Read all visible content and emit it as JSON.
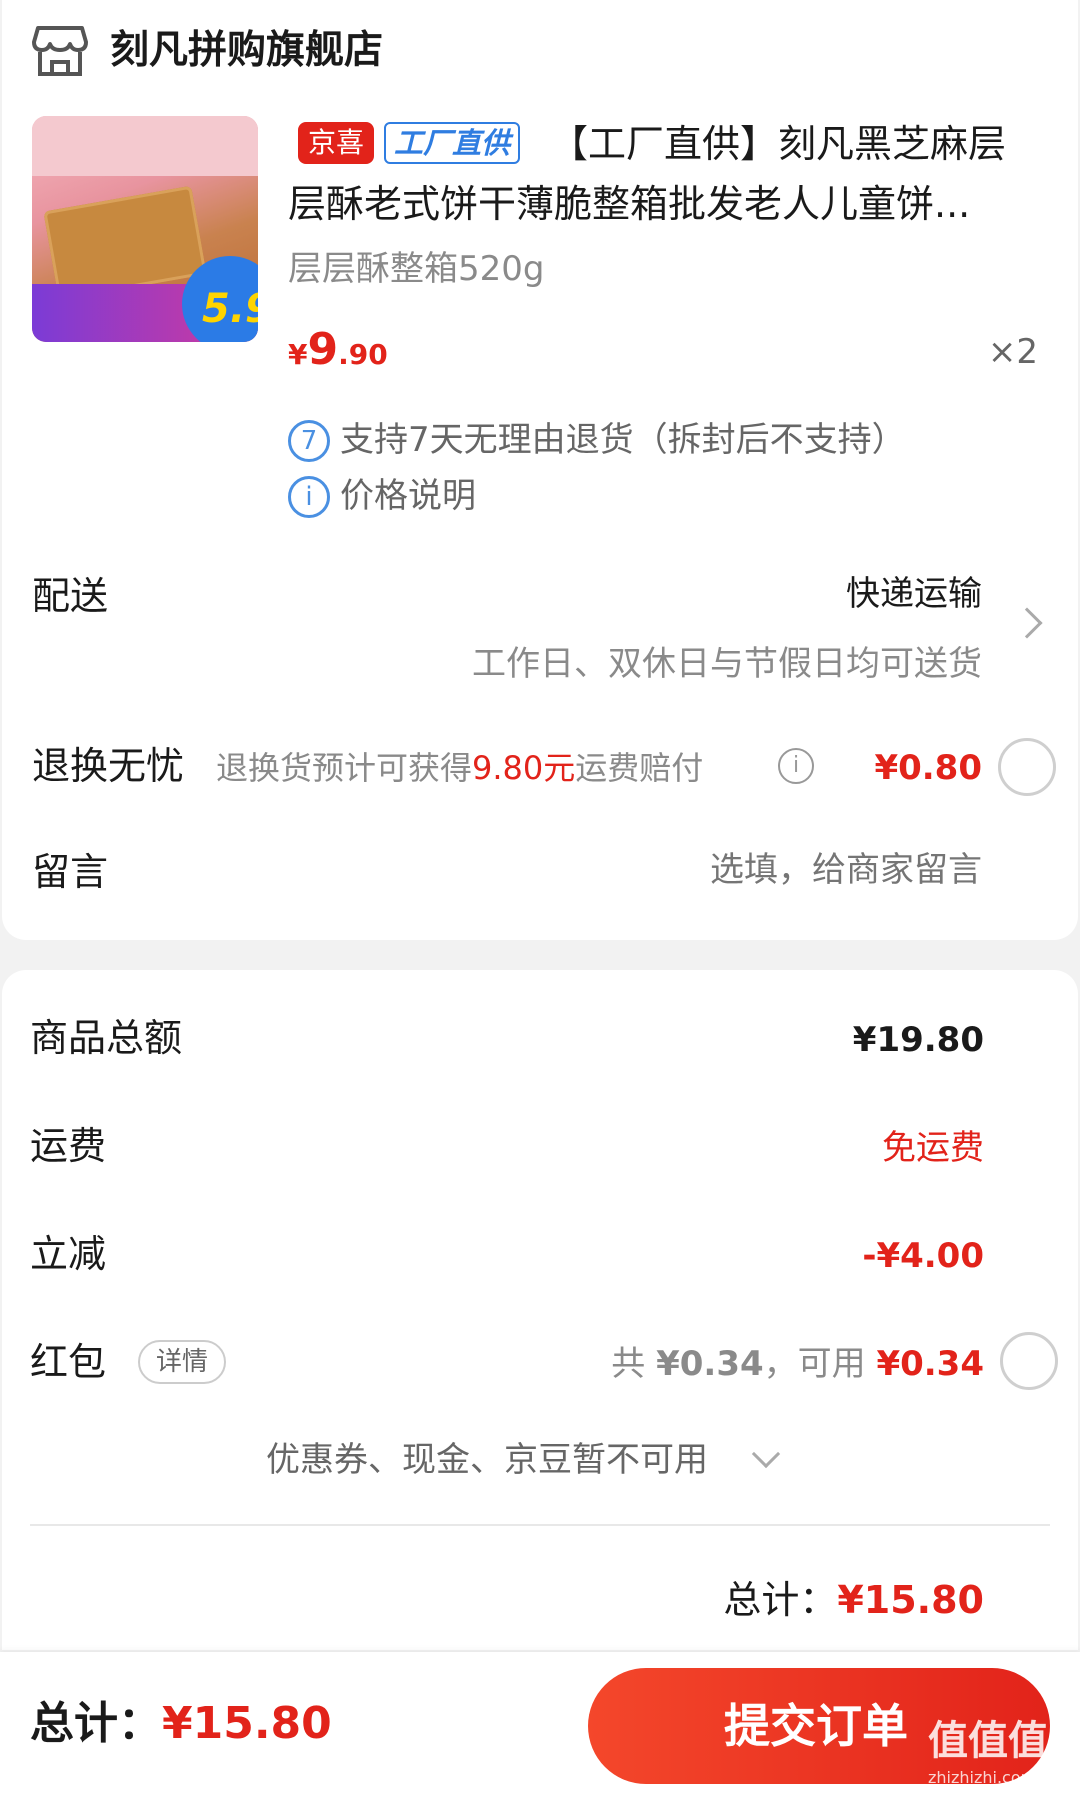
{
  "store": {
    "icon": "store-icon",
    "name": "刻凡拼购旗舰店"
  },
  "product": {
    "thumbnail_text": "5.9",
    "tags": {
      "jingxi": "京喜",
      "factory": "工厂直供"
    },
    "title_line1": "【工厂直供】刻凡黑芝麻层",
    "title_line2": "层酥老式饼干薄脆整箱批发老人儿童饼...",
    "spec": "层层酥整箱520g",
    "price": {
      "currency": "¥",
      "integer": "9",
      "decimal": ".90"
    },
    "quantity": "×2",
    "service1": {
      "icon_text": "7",
      "text": "支持7天无理由退货（拆封后不支持）"
    },
    "service2": {
      "icon_text": "i",
      "text": "价格说明"
    }
  },
  "delivery": {
    "label": "配送",
    "value": "快递运输",
    "note": "工作日、双休日与节假日均可送货"
  },
  "return_worry": {
    "label": "退换无忧",
    "desc_prefix": "退换货预计可获得",
    "desc_amount": "9.80元",
    "desc_suffix": "运费赔付",
    "price": "¥0.80"
  },
  "message": {
    "label": "留言",
    "placeholder": "选填，给商家留言"
  },
  "summary": {
    "goods_label": "商品总额",
    "goods_value": "¥19.80",
    "freight_label": "运费",
    "freight_value": "免运费",
    "reduce_label": "立减",
    "reduce_value": "-¥4.00",
    "redpack_label": "红包",
    "redpack_detail": "详情",
    "redpack_total_prefix": "共 ",
    "redpack_total": "¥0.34",
    "redpack_available_prefix": "，可用 ",
    "redpack_available": "¥0.34",
    "coupon_note": "优惠券、现金、京豆暂不可用",
    "total_label": "总计：",
    "total_value": "¥15.80"
  },
  "bottom_bar": {
    "total_label": "总计：",
    "total_value": "¥15.80",
    "submit_label": "提交订单"
  },
  "watermark": {
    "text": "值值值",
    "sub": "zhizhizhi.com"
  }
}
